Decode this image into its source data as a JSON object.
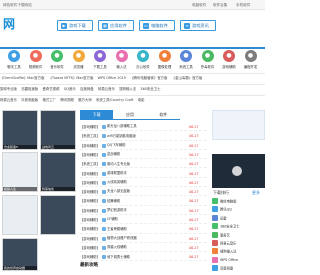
{
  "topbar": {
    "left": "绿色软件下载网站",
    "right": [
      "电脑软件",
      "软件合集",
      "手机软件"
    ]
  },
  "header": {
    "logo": "网",
    "nav": [
      {
        "label": "游戏下载",
        "icon": "gamepad-icon"
      },
      {
        "label": "应用软件",
        "icon": "app-icon"
      },
      {
        "label": "电脑软件",
        "icon": "monitor-icon"
      },
      {
        "label": "游戏资讯",
        "icon": "news-icon"
      }
    ]
  },
  "categories": [
    {
      "label": "聊天工具",
      "color": "#3fa0e6"
    },
    {
      "label": "视频软件",
      "color": "#ef6b5a"
    },
    {
      "label": "音乐软件",
      "color": "#45bf6b"
    },
    {
      "label": "浏览器",
      "color": "#f2a93b"
    },
    {
      "label": "下载工具",
      "color": "#8a68d6"
    },
    {
      "label": "输入法",
      "color": "#e86fb0"
    },
    {
      "label": "办公软件",
      "color": "#38b7c9"
    },
    {
      "label": "图像处理",
      "color": "#f07f3c"
    },
    {
      "label": "系统工具",
      "color": "#5c86d8"
    },
    {
      "label": "杀毒软件",
      "color": "#4bb862"
    },
    {
      "label": "游戏辅助",
      "color": "#d85c5c"
    },
    {
      "label": "编程开发",
      "color": "#7c7c7c"
    }
  ],
  "keywords": {
    "row1": [
      "《OmniGraffle》Mac官方版",
      "《Tuxera NTFS》Mac官方版",
      "WPS Office 2019",
      "《腾讯电脑管家》官方版",
      "《金山毒霸》官方版"
    ],
    "row2": [
      "剪映专业版",
      "迅雷极速版",
      "爱奇艺视频",
      "QQ音乐",
      "百度网盘",
      "网易云音乐",
      "搜狗输入法",
      "360安全卫士"
    ],
    "row3": [
      "网易云音乐",
      "抖音电脑版",
      "格式工厂",
      "腾讯视频",
      "魔方大师",
      "系统工具ICountry Craft",
      "电影"
    ]
  },
  "banners": [
    {
      "caption": "合金装备5",
      "dark": true
    },
    {
      "caption": "战地风云",
      "dark": true
    },
    {
      "caption": "模拟人生",
      "dark": false
    },
    {
      "caption": "刺客信条",
      "dark": true
    },
    {
      "caption": "",
      "dark": false
    },
    {
      "caption": "",
      "dark": true
    }
  ],
  "banner_big_caption": "我的世界启动器",
  "tabs": [
    "下载",
    "应用",
    "软件"
  ],
  "list": [
    {
      "cat": "【游戏辅助】",
      "title": "新天龙八部辅助工具",
      "date": "06-27"
    },
    {
      "cat": "【系统工具】",
      "title": "wifi万能钥匙电脑版",
      "date": "06-27"
    },
    {
      "cat": "【游戏辅助】",
      "title": "QQ飞车辅助",
      "date": "06-27"
    },
    {
      "cat": "【游戏辅助】",
      "title": "逆战辅助",
      "date": "06-27"
    },
    {
      "cat": "【系统工具】",
      "title": "驱动人生专业版",
      "date": "06-27"
    },
    {
      "cat": "【游戏辅助】",
      "title": "英雄联盟助手",
      "date": "06-27"
    },
    {
      "cat": "【游戏辅助】",
      "title": "火线精英辅助",
      "date": "06-27"
    },
    {
      "cat": "【游戏辅助】",
      "title": "天龙八部无敌版",
      "date": "06-27"
    },
    {
      "cat": "【游戏辅助】",
      "title": "炫舞辅助",
      "date": "06-27"
    },
    {
      "cat": "【游戏辅助】",
      "title": "梦幻西游助手",
      "date": "06-27"
    },
    {
      "cat": "【游戏辅助】",
      "title": "CF辅助",
      "date": "06-27"
    },
    {
      "cat": "【游戏辅助】",
      "title": "王者荣耀辅助",
      "date": "06-27"
    },
    {
      "cat": "【游戏辅助】",
      "title": "植物大战僵尸修改器",
      "date": "06-27"
    },
    {
      "cat": "【游戏辅助】",
      "title": "穿越火线辅助",
      "date": "06-27"
    },
    {
      "cat": "【游戏辅助】",
      "title": "地下城勇士辅助",
      "date": "06-27"
    }
  ],
  "latest_heading": "最新攻略",
  "right": {
    "header": "下载排行",
    "more": "更多",
    "items": [
      {
        "title": "微信电脑版",
        "color": "#45bf6b"
      },
      {
        "title": "腾讯QQ",
        "color": "#3fa0e6"
      },
      {
        "title": "迅雷",
        "color": "#5c86d8"
      },
      {
        "title": "360安全卫士",
        "color": "#45bf6b"
      },
      {
        "title": "爱奇艺",
        "color": "#4bb862"
      },
      {
        "title": "网易云音乐",
        "color": "#d85c5c"
      },
      {
        "title": "搜狗输入法",
        "color": "#f07f3c"
      },
      {
        "title": "WPS Office",
        "color": "#e86fb0"
      },
      {
        "title": "百度网盘",
        "color": "#3fa0e6"
      }
    ]
  }
}
